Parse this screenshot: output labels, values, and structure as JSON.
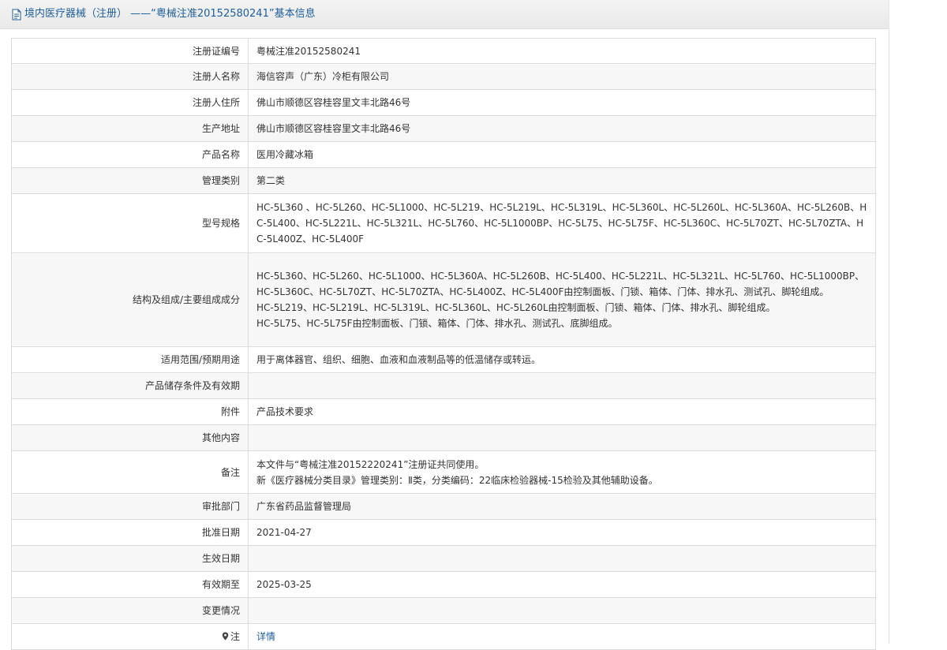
{
  "header": {
    "title": "境内医疗器械（注册） ——“粤械注准20152580241”基本信息"
  },
  "rows": [
    {
      "label": "注册证编号",
      "value": [
        "粤械注准20152580241"
      ]
    },
    {
      "label": "注册人名称",
      "value": [
        "海信容声（广东）冷柜有限公司"
      ]
    },
    {
      "label": "注册人住所",
      "value": [
        "佛山市顺德区容桂容里文丰北路46号"
      ]
    },
    {
      "label": "生产地址",
      "value": [
        "佛山市顺德区容桂容里文丰北路46号"
      ]
    },
    {
      "label": "产品名称",
      "value": [
        "医用冷藏冰箱"
      ]
    },
    {
      "label": "管理类别",
      "value": [
        "第二类"
      ]
    },
    {
      "label": "型号规格",
      "value": [
        "HC-5L360 、HC-5L260、HC-5L1000、HC-5L219、HC-5L219L、HC-5L319L、HC-5L360L、HC-5L260L、HC-5L360A、HC-5L260B、HC-5L400、HC-5L221L、HC-5L321L、HC-5L760、HC-5L1000BP、HC-5L75、HC-5L75F、HC-5L360C、HC-5L70ZT、HC-5L70ZTA、HC-5L400Z、HC-5L400F"
      ]
    },
    {
      "label": "结构及组成/主要组成成分",
      "value": [
        "HC-5L360、HC-5L260、HC-5L1000、HC-5L360A、HC-5L260B、HC-5L400、HC-5L221L、HC-5L321L、HC-5L760、HC-5L1000BP、HC-5L360C、HC-5L70ZT、HC-5L70ZTA、HC-5L400Z、HC-5L400F由控制面板、门锁、箱体、门体、排水孔、测试孔、脚轮组成。",
        "HC-5L219、HC-5L219L、HC-5L319L、HC-5L360L、HC-5L260L由控制面板、门锁、箱体、门体、排水孔、脚轮组成。",
        "HC-5L75、HC-5L75F由控制面板、门锁、箱体、门体、排水孔、测试孔、底脚组成。"
      ]
    },
    {
      "label": "适用范围/预期用途",
      "value": [
        "用于离体器官、组织、细胞、血液和血液制品等的低温储存或转运。"
      ]
    },
    {
      "label": "产品储存条件及有效期",
      "value": [
        ""
      ]
    },
    {
      "label": "附件",
      "value": [
        "产品技术要求"
      ]
    },
    {
      "label": "其他内容",
      "value": [
        ""
      ]
    },
    {
      "label": "备注",
      "value": [
        "本文件与“粤械注准20152220241”注册证共同使用。",
        "新《医疗器械分类目录》管理类别：Ⅱ类，分类编码：22临床检验器械-15检验及其他辅助设备。"
      ]
    },
    {
      "label": "审批部门",
      "value": [
        "广东省药品监督管理局"
      ]
    },
    {
      "label": "批准日期",
      "value": [
        "2021-04-27"
      ]
    },
    {
      "label": "生效日期",
      "value": [
        ""
      ]
    },
    {
      "label": "有效期至",
      "value": [
        "2025-03-25"
      ]
    },
    {
      "label": "变更情况",
      "value": [
        ""
      ]
    }
  ],
  "note_row": {
    "label": "注",
    "link": "详情"
  },
  "colors": {
    "header_text": "#1d5e9c",
    "link": "#1d5e9c",
    "border": "#dcdcdc",
    "stripe": "#f7f7f7"
  }
}
